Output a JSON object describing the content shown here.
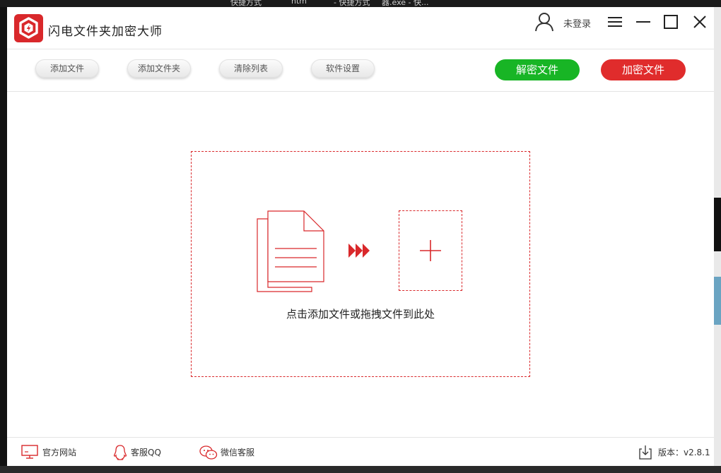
{
  "taskbar_fragments": [
    "快捷方式",
    "htm",
    "- 快捷方式",
    "器.exe - 快..."
  ],
  "app": {
    "title": "闪电文件夹加密大师",
    "brand_color": "#d9282b"
  },
  "header": {
    "user_icon": "user-icon",
    "login_label": "未登录",
    "window_controls": [
      "menu-icon",
      "minimize-icon",
      "maximize-icon",
      "close-icon"
    ]
  },
  "toolbar": {
    "buttons": [
      {
        "label": "添加文件"
      },
      {
        "label": "添加文件夹"
      },
      {
        "label": "清除列表"
      },
      {
        "label": "软件设置"
      }
    ],
    "decrypt_label": "解密文件",
    "encrypt_label": "加密文件",
    "decrypt_color": "#18b525",
    "encrypt_color": "#e02c2c"
  },
  "drop_zone": {
    "icons": [
      "document-icon",
      "forward-arrows-icon",
      "plus-icon"
    ],
    "hint": "点击添加文件或拖拽文件到此处"
  },
  "statusbar": {
    "links": [
      {
        "label": "官方网站",
        "icon": "monitor-icon"
      },
      {
        "label": "客服QQ",
        "icon": "qq-icon"
      },
      {
        "label": "微信客服",
        "icon": "wechat-icon"
      }
    ],
    "version_label": "版本：v2.8.1",
    "version_icon": "download-icon"
  }
}
